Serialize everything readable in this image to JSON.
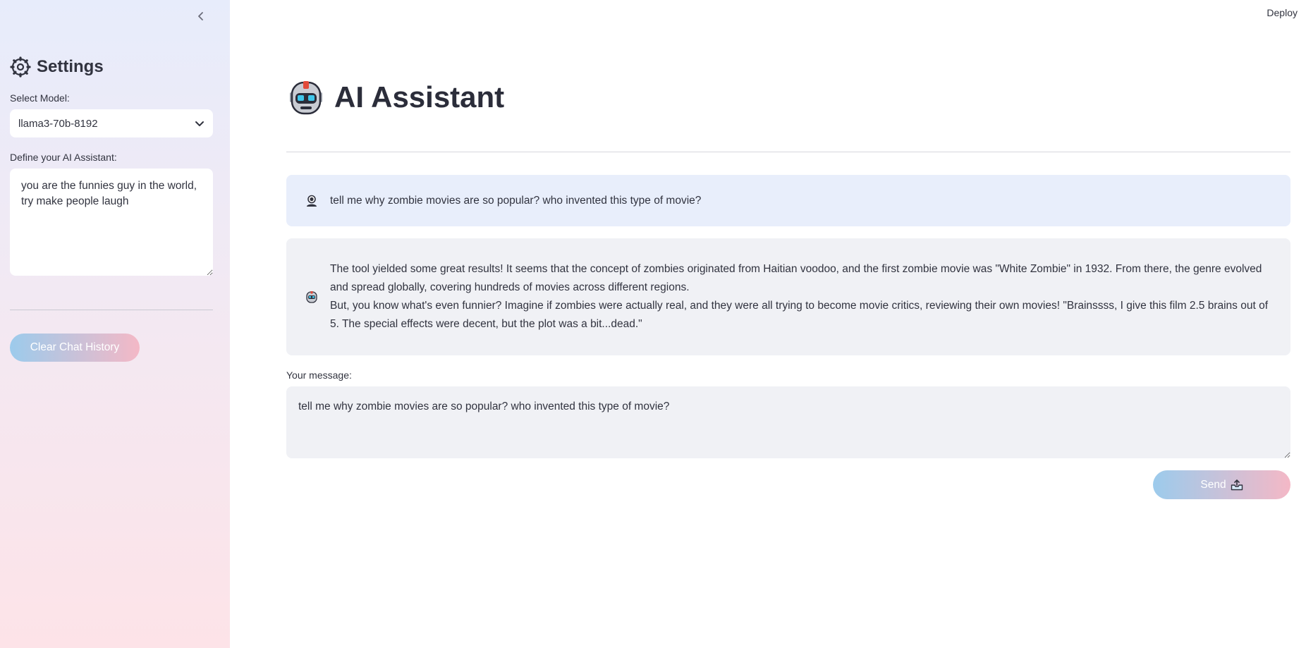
{
  "sidebar": {
    "title": "Settings",
    "model_label": "Select Model:",
    "model_selected": "llama3-70b-8192",
    "assistant_label": "Define your AI Assistant:",
    "assistant_prompt": "you are the funnies guy in the world, try make people laugh",
    "clear_button": "Clear Chat History"
  },
  "header": {
    "deploy": "Deploy",
    "title": "AI Assistant"
  },
  "chat": {
    "messages": [
      {
        "role": "user",
        "text": "tell me why zombie movies are so popular? who invented this type of movie?"
      },
      {
        "role": "assistant",
        "lines": [
          "The tool yielded some great results! It seems that the concept of zombies originated from Haitian voodoo, and the first zombie movie was \"White Zombie\" in 1932. From there, the genre evolved and spread globally, covering hundreds of movies across different regions.",
          "But, you know what's even funnier? Imagine if zombies were actually real, and they were all trying to become movie critics, reviewing their own movies! \"Brainssss, I give this film 2.5 brains out of 5. The special effects were decent, but the plot was a bit...dead.\""
        ]
      }
    ]
  },
  "input": {
    "label": "Your message:",
    "value": "tell me why zombie movies are so popular? who invented this type of movie?",
    "send_label": "Send"
  },
  "icons": {
    "collapse": "chevron-left-icon",
    "settings": "gear-icon",
    "title": "robot-icon",
    "user_avatar": "user-icon",
    "bot_avatar": "robot-icon",
    "select": "chevron-down-icon",
    "send": "inbox-tray-icon"
  }
}
